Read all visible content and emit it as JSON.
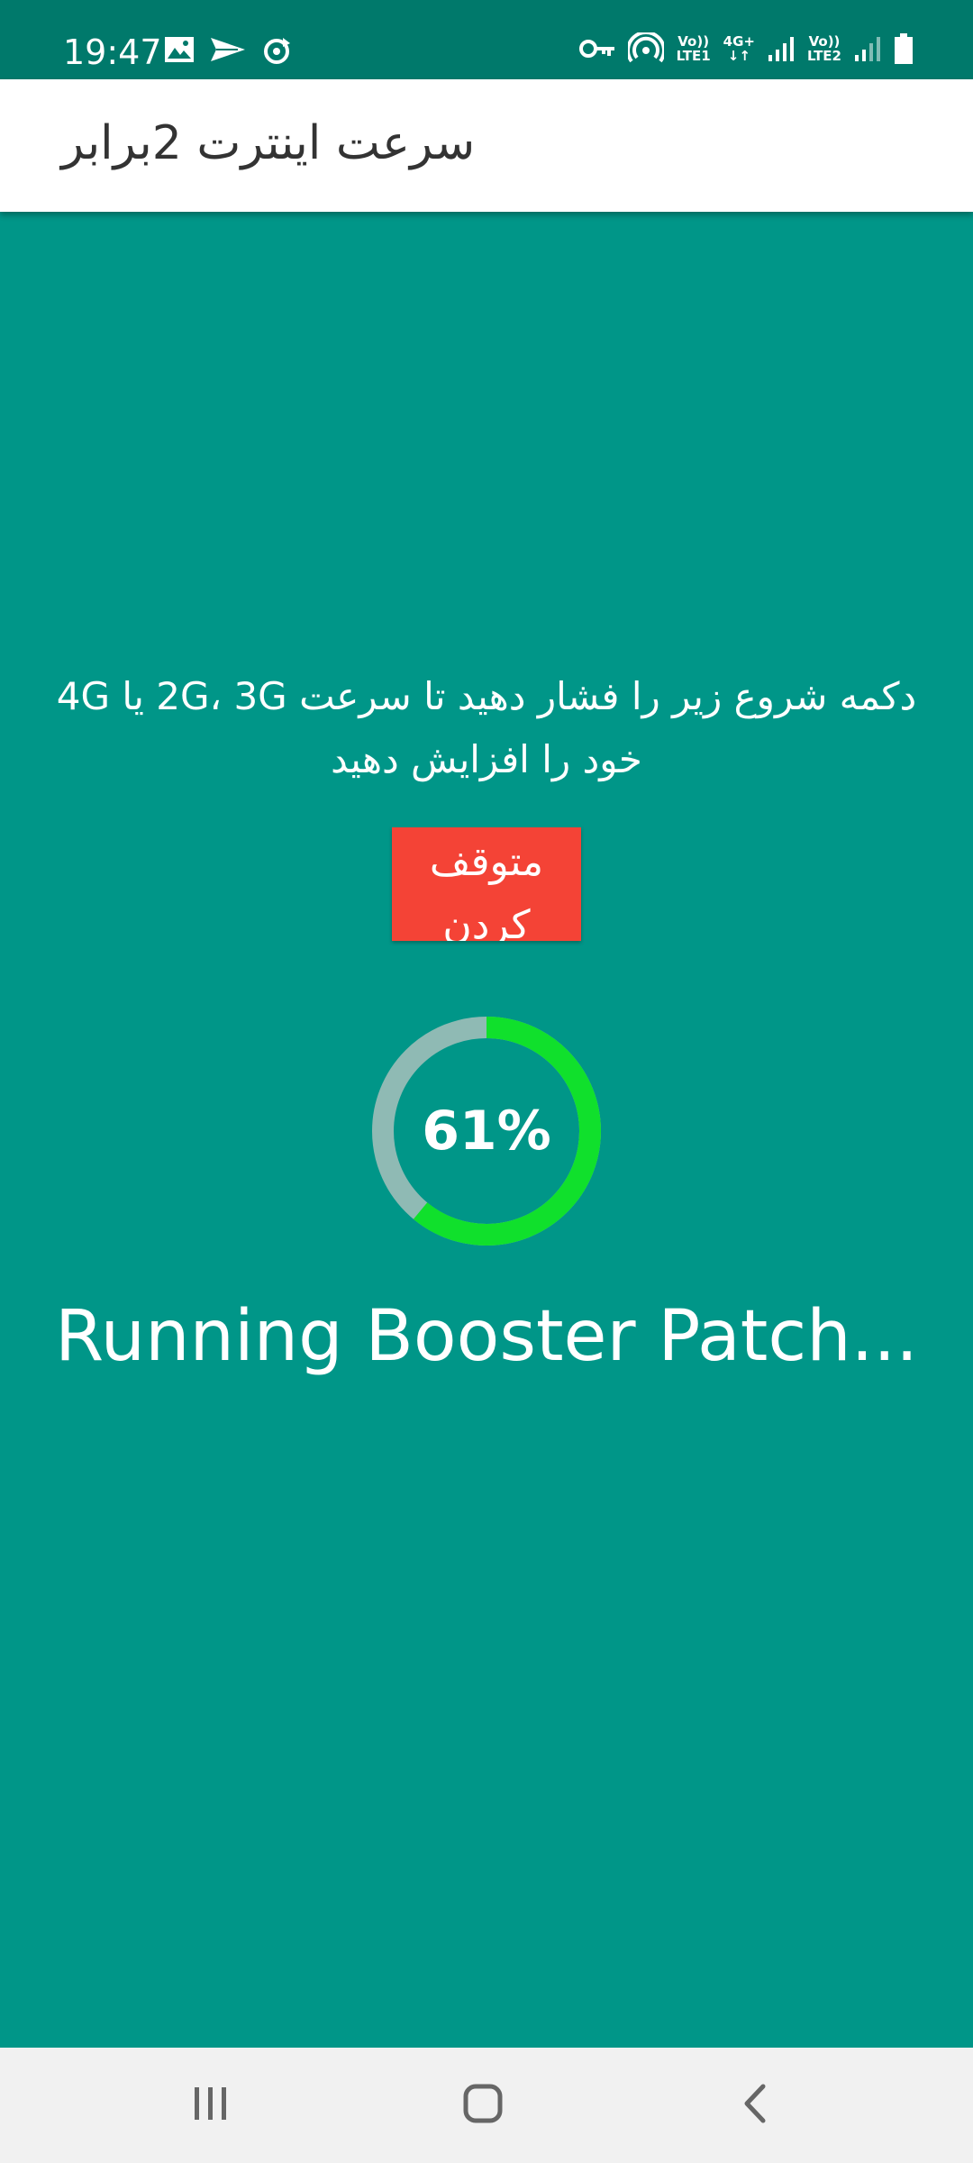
{
  "status_bar": {
    "time": "19:47",
    "left_icons": [
      "image-icon",
      "send-icon",
      "sync-icon"
    ],
    "right_icons": [
      "vpn-key-icon",
      "hotspot-icon",
      "signal-sim1-icon",
      "signal-sim2-icon",
      "battery-icon"
    ],
    "sim1_label_top": "Vo))",
    "sim1_label_bottom": "LTE1",
    "network_type": "4G+",
    "sim2_label_top": "Vo))",
    "sim2_label_bottom": "LTE2"
  },
  "app_bar": {
    "title": "سرعت اینترت 2برابر"
  },
  "main": {
    "instruction": "دکمه شروع زیر را فشار دهید تا سرعت 2G، 3G یا 4G خود را افزایش دهید",
    "stop_button_label": "متوقف کردن",
    "progress": {
      "value": 0.61,
      "label": "61%",
      "track_color": "#8fbab4",
      "fill_color": "#10e02c"
    },
    "status_message": "Running Booster Patch..."
  },
  "nav_bar": {
    "buttons": [
      "recent-apps-icon",
      "home-icon",
      "back-icon"
    ]
  },
  "colors": {
    "background": "#009688",
    "status_bar": "#00796b",
    "stop_button": "#f44336",
    "nav_bar": "#f1f1f1"
  }
}
